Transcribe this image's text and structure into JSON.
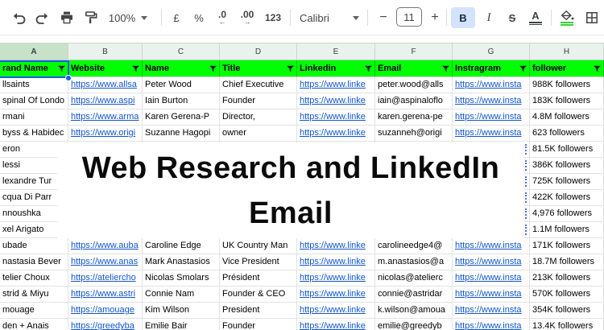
{
  "toolbar": {
    "zoom_level": "100%",
    "currency": "£",
    "percent": "%",
    "decrease_decimal": ".0",
    "decrease_arrow": "←",
    "increase_decimal": ".00",
    "increase_arrow": "→",
    "number_format": "123",
    "font_name": "Calibri",
    "font_size": "11",
    "minus": "−",
    "plus": "+",
    "bold": "B",
    "italic": "I",
    "strikethrough": "S",
    "text_color": "A"
  },
  "colors": {
    "header_green": "#00ff00",
    "link_blue": "#1155cc",
    "selection_blue": "#1a5ceb",
    "active_button_bg": "#d3e3fd",
    "fill_accent_green": "#35d435"
  },
  "columns": [
    "A",
    "B",
    "C",
    "D",
    "E",
    "F",
    "G",
    "H"
  ],
  "header_row": [
    "rand Name",
    "Website",
    "Name",
    "Title",
    "Linkedin",
    "Email",
    "Instragram",
    "follower"
  ],
  "overlay": {
    "line1": "Web Research and LinkedIn",
    "line2": "Email"
  },
  "rows": [
    {
      "brand": "llsaints",
      "website": "https://www.allsa",
      "name": "Peter Wood",
      "title": "Chief Executive",
      "linkedin": "https://www.linke",
      "email": "peter.wood@alls",
      "instagram": "https://www.insta",
      "followers": "988K followers"
    },
    {
      "brand": "spinal Of Londo",
      "website": "https://www.aspi",
      "name": "Iain Burton",
      "title": "Founder",
      "linkedin": "https://www.linke",
      "email": "iain@aspinaloflo",
      "instagram": "https://www.insta",
      "followers": "183K followers"
    },
    {
      "brand": "rmani",
      "website": "https://www.arma",
      "name": "Karen Gerena-P",
      "title": "Director,",
      "linkedin": "https://www.linke",
      "email": "karen.gerena-pe",
      "instagram": "https://www.insta",
      "followers": "4.8M followers"
    },
    {
      "brand": "byss & Habidec",
      "website": "https://www.origi",
      "name": "Suzanne Hagopi",
      "title": "owner",
      "linkedin": "https://www.linke",
      "email": "suzanneh@origi",
      "instagram": "https://www.insta",
      "followers": "623 followers"
    },
    {
      "brand": "eron",
      "website": "",
      "name": "",
      "title": "",
      "linkedin": "",
      "email": "",
      "instagram": "",
      "followers": "81.5K followers"
    },
    {
      "brand": "lessi",
      "website": "",
      "name": "",
      "title": "",
      "linkedin": "",
      "email": "",
      "instagram": "",
      "followers": "386K followers"
    },
    {
      "brand": "lexandre Tur",
      "website": "",
      "name": "",
      "title": "",
      "linkedin": "",
      "email": "",
      "instagram": "",
      "followers": "725K followers"
    },
    {
      "brand": "cqua Di Parr",
      "website": "",
      "name": "",
      "title": "",
      "linkedin": "",
      "email": "",
      "instagram": "",
      "followers": "422K followers"
    },
    {
      "brand": "nnoushka",
      "website": "",
      "name": "",
      "title": "",
      "linkedin": "",
      "email": "",
      "instagram": "",
      "followers": "4,976 followers"
    },
    {
      "brand": "xel Arigato",
      "website": "",
      "name": "",
      "title": "",
      "linkedin": "",
      "email": "",
      "instagram": "",
      "followers": "1.1M followers"
    },
    {
      "brand": "ubade",
      "website": "https://www.auba",
      "name": "Caroline Edge",
      "title": "UK Country Man",
      "linkedin": "https://www.linke",
      "email": "carolineedge4@",
      "instagram": "https://www.insta",
      "followers": "171K followers"
    },
    {
      "brand": "nastasia Bever",
      "website": "https://www.anas",
      "name": "Mark Anastasios",
      "title": "Vice President",
      "linkedin": "https://www.linke",
      "email": "m.anastasios@a",
      "instagram": "https://www.insta",
      "followers": "18.7M followers"
    },
    {
      "brand": "telier Choux",
      "website": "https://ateliercho",
      "name": "Nicolas Smolars",
      "title": "Président",
      "linkedin": "https://www.linke",
      "email": "nicolas@atelierc",
      "instagram": "https://www.insta",
      "followers": "213K followers"
    },
    {
      "brand": "strid & Miyu",
      "website": "https://www.astri",
      "name": "Connie Nam",
      "title": "Founder & CEO",
      "linkedin": "https://www.linke",
      "email": "connie@astridar",
      "instagram": "https://www.insta",
      "followers": "570K followers"
    },
    {
      "brand": "mouage",
      "website": "https://amouage",
      "name": "Kim Wilson",
      "title": "President",
      "linkedin": "https://www.linke",
      "email": "k.wilson@amoua",
      "instagram": "https://www.insta",
      "followers": "354K followers"
    },
    {
      "brand": "den + Anais",
      "website": "https://greedyba",
      "name": "Emilie Bair",
      "title": "Founder",
      "linkedin": "https://www.linke",
      "email": "emilie@greedyb",
      "instagram": "https://www.insta",
      "followers": "13.4K followers"
    }
  ]
}
